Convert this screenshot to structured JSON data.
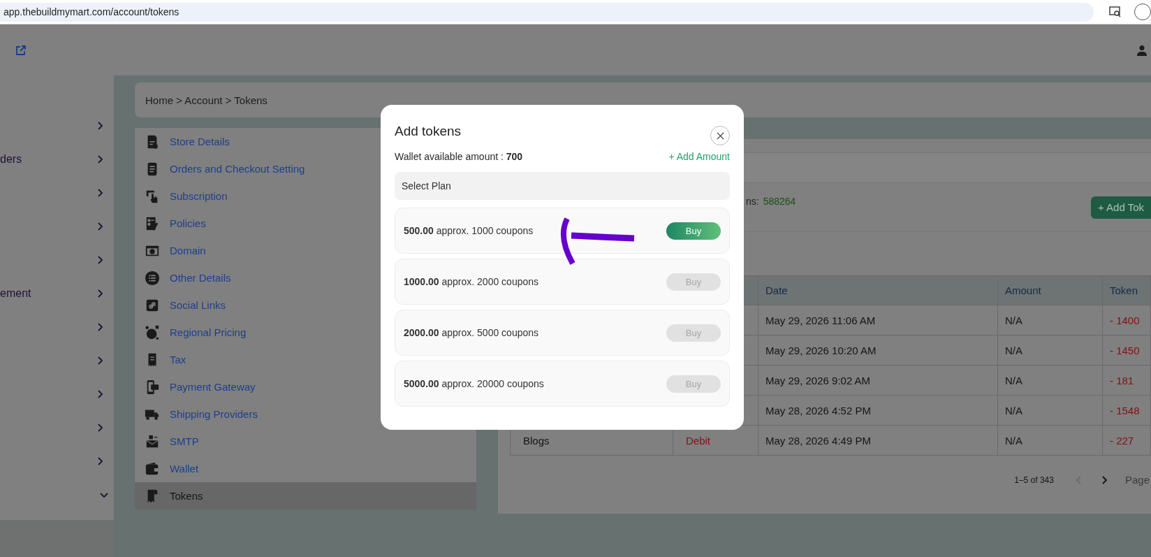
{
  "browser": {
    "url": "app.thebuildmymart.com/account/tokens"
  },
  "left_nav": [
    {
      "expanded": false
    },
    {
      "label": "ders",
      "expanded": false
    },
    {
      "expanded": false
    },
    {
      "expanded": false
    },
    {
      "expanded": false
    },
    {
      "label": "ement",
      "expanded": false
    },
    {
      "expanded": false
    },
    {
      "expanded": false
    },
    {
      "expanded": false
    },
    {
      "expanded": false
    },
    {
      "expanded": false
    },
    {
      "expanded": true
    }
  ],
  "breadcrumb": "Home > Account > Tokens",
  "settings_menu": [
    {
      "label": "Store Details",
      "selected": false
    },
    {
      "label": "Orders and Checkout Setting",
      "selected": false
    },
    {
      "label": "Subscription",
      "selected": false
    },
    {
      "label": "Policies",
      "selected": false
    },
    {
      "label": "Domain",
      "selected": false
    },
    {
      "label": "Other Details",
      "selected": false
    },
    {
      "label": "Social Links",
      "selected": false
    },
    {
      "label": "Regional Pricing",
      "selected": false
    },
    {
      "label": "Tax",
      "selected": false
    },
    {
      "label": "Payment Gateway",
      "selected": false
    },
    {
      "label": "Shipping Providers",
      "selected": false
    },
    {
      "label": "SMTP",
      "selected": false
    },
    {
      "label": "Wallet",
      "selected": false
    },
    {
      "label": "Tokens",
      "selected": true
    }
  ],
  "tokens_panel": {
    "balance_label": "ns:",
    "balance_value": "588264",
    "add_button": "+ Add Tok"
  },
  "table": {
    "columns": [
      "Date",
      "Amount",
      "Token"
    ],
    "rows": [
      {
        "date": "May 29, 2026 11:06 AM",
        "amount": "N/A",
        "token": "- 1400"
      },
      {
        "date": "May 29, 2026 10:20 AM",
        "amount": "N/A",
        "token": "- 1450"
      },
      {
        "date": "May 29, 2026 9:02 AM",
        "amount": "N/A",
        "token": "- 181"
      },
      {
        "date": "May 28, 2026 4:52 PM",
        "amount": "N/A",
        "token": "- 1548"
      },
      {
        "column_1": "Blogs",
        "column_2": "Debit",
        "date": "May 28, 2026 4:49 PM",
        "amount": "N/A",
        "token": "- 227"
      }
    ]
  },
  "pagination": {
    "range": "1–5 of 343",
    "previous_disabled": true,
    "page_label": "Page"
  },
  "modal": {
    "title": "Add tokens",
    "wallet_text": "Wallet available amount : **700**",
    "add_amount": "+ Add Amount",
    "plan_select": {
      "placeholder": "Select Plan"
    },
    "plans": [
      {
        "text": "**500.00** approx. 1000 coupons",
        "button": "Buy",
        "disabled": false
      },
      {
        "text": "**1000.00** approx. 2000 coupons",
        "button": "Buy",
        "disabled": true
      },
      {
        "text": "**2000.00** approx. 5000 coupons",
        "button": "Buy",
        "disabled": true
      },
      {
        "text": "**5000.00** approx. 20000 coupons",
        "button": "Buy",
        "disabled": true
      }
    ]
  }
}
